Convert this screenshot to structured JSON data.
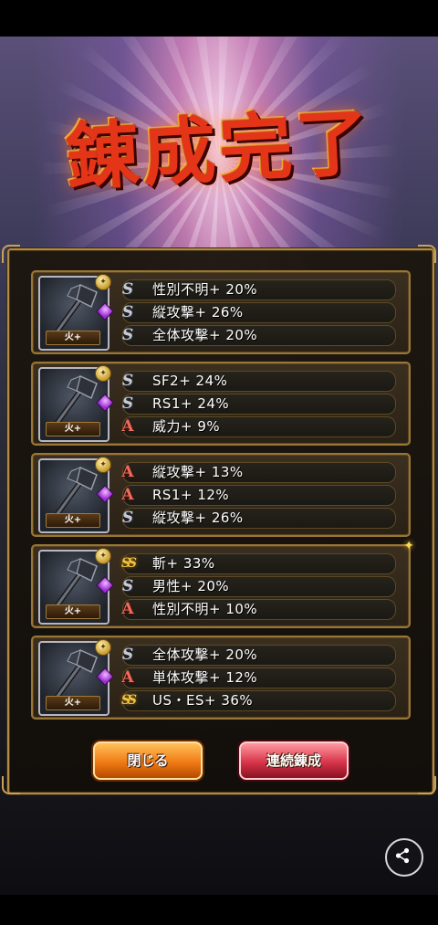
{
  "title": "錬成完了",
  "cards": [
    {
      "element": "火+",
      "stats": [
        {
          "icon": "S",
          "type": "s",
          "text": "性別不明+ 20%"
        },
        {
          "icon": "S",
          "type": "s",
          "text": "縦攻撃+ 26%"
        },
        {
          "icon": "S",
          "type": "s",
          "text": "全体攻撃+ 20%"
        }
      ]
    },
    {
      "element": "火+",
      "stats": [
        {
          "icon": "S",
          "type": "s",
          "text": "SF2+ 24%"
        },
        {
          "icon": "S",
          "type": "s",
          "text": "RS1+ 24%"
        },
        {
          "icon": "A",
          "type": "a",
          "text": "威力+ 9%"
        }
      ]
    },
    {
      "element": "火+",
      "stats": [
        {
          "icon": "A",
          "type": "a",
          "text": "縦攻撃+ 13%"
        },
        {
          "icon": "A",
          "type": "a",
          "text": "RS1+ 12%"
        },
        {
          "icon": "S",
          "type": "s",
          "text": "縦攻撃+ 26%"
        }
      ]
    },
    {
      "element": "火+",
      "stats": [
        {
          "icon": "SS",
          "type": "ss",
          "text": "斬+ 33%"
        },
        {
          "icon": "S",
          "type": "s",
          "text": "男性+ 20%"
        },
        {
          "icon": "A",
          "type": "a",
          "text": "性別不明+ 10%"
        }
      ]
    },
    {
      "element": "火+",
      "stats": [
        {
          "icon": "S",
          "type": "s",
          "text": "全体攻撃+ 20%"
        },
        {
          "icon": "A",
          "type": "a",
          "text": "単体攻撃+ 12%"
        },
        {
          "icon": "SS",
          "type": "ss",
          "text": "US・ES+ 36%"
        }
      ]
    }
  ],
  "buttons": {
    "close": "閉じる",
    "continue": "連続錬成"
  },
  "share_icon": "share-icon",
  "colors": {
    "title_red": "#e53518",
    "frame_gold": "#b28a46",
    "rank_s": "#c6cbd8",
    "rank_a": "#f06a5a",
    "rank_ss": "#f2c443",
    "close_orange": "#f07a14",
    "continue_red": "#d8344a"
  }
}
